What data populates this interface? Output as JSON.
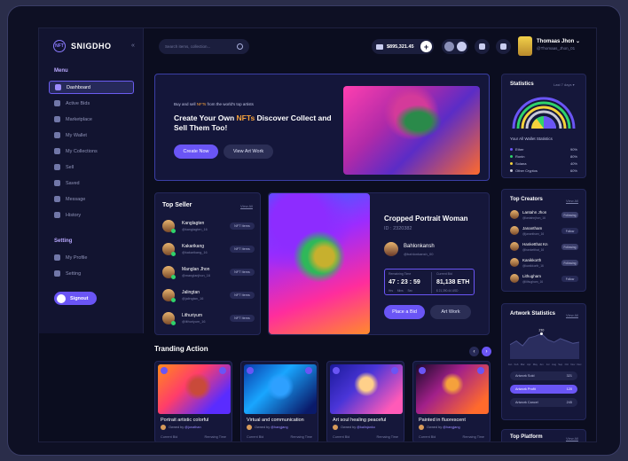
{
  "brand": {
    "name": "SNIGDHO",
    "logo_text": "NFT"
  },
  "sidebar": {
    "menu_title": "Menu",
    "items": [
      {
        "label": "Dashboard",
        "active": true
      },
      {
        "label": "Active Bids"
      },
      {
        "label": "Marketplace"
      },
      {
        "label": "My Wallet"
      },
      {
        "label": "My Collections"
      },
      {
        "label": "Sell"
      },
      {
        "label": "Saved"
      },
      {
        "label": "Message"
      },
      {
        "label": "History"
      }
    ],
    "setting_title": "Setting",
    "setting_items": [
      {
        "label": "My Profile"
      },
      {
        "label": "Setting"
      }
    ],
    "signout": "Signout"
  },
  "header": {
    "search_placeholder": "Search items, collection...",
    "wallet_amount": "$895,321.45",
    "user_name": "Thomaas Jhon",
    "user_handle": "@Thomaas_Jhon_01"
  },
  "hero": {
    "sub_prefix": "Buy and sell ",
    "sub_hl": "NFTs",
    "sub_suffix": " from the world's top artists",
    "title_a": "Create Your Own ",
    "title_hl": "NFTs",
    "title_b": " Discover Collect and Sell Them Too!",
    "btn_create": "Create Now",
    "btn_view": "View Art Work"
  },
  "top_seller": {
    "title": "Top Seller",
    "view_all": "View All",
    "sellers": [
      {
        "name": "Kanglagten",
        "handle": "@kanglagten_16",
        "badge": "NFT Items"
      },
      {
        "name": "Kakarikang",
        "handle": "@kakarikang_16",
        "badge": "NFT Items"
      },
      {
        "name": "Manglan Jhon",
        "handle": "@manglanjhon_16",
        "badge": "NFT Items"
      },
      {
        "name": "Jalingtan",
        "handle": "@jalingtan_16",
        "badge": "NFT Items"
      },
      {
        "name": "Lithuriyum",
        "handle": "@lithuriyum_16",
        "badge": "NFT Items"
      }
    ]
  },
  "featured": {
    "title": "Cropped Portrait Woman",
    "id": "ID : 2320382",
    "owner": "Bahlonkansh",
    "owner_handle": "@bahlonkansh_00",
    "remaining_label": "Remaining Time",
    "remaining_value": "47 : 23 : 59",
    "remaining_units": "Hrs Mins Sec",
    "bid_label": "Current Bid",
    "bid_value": "81,138 ETH",
    "bid_sub": "$ 21,390.44 USD",
    "btn_bid": "Place a Bid",
    "btn_art": "Art Work"
  },
  "trending": {
    "title": "Tranding Action",
    "cards": [
      {
        "title": "Portrait artistic colorful",
        "by": "Owned by ",
        "owner": "@jonathan",
        "l1": "Current Bid",
        "l2": "Remaing Time"
      },
      {
        "title": "Virtual and communication",
        "by": "Owned by ",
        "owner": "@hangjang",
        "l1": "Current Bid",
        "l2": "Remaing Time"
      },
      {
        "title": "Art soul healing peaceful",
        "by": "Owned by ",
        "owner": "@kalinjanko",
        "l1": "Current Bid",
        "l2": "Remaing Time"
      },
      {
        "title": "Painted in fluorescent",
        "by": "Owned by ",
        "owner": "@hangjang",
        "l1": "Current Bid",
        "l2": "Remaing Time"
      }
    ]
  },
  "statistics": {
    "title": "Statistics",
    "range": "Last 7 days ▾",
    "subtitle": "Your All Wallet Statistics",
    "items": [
      {
        "label": "Ether",
        "value": "90%",
        "color": "#6a55f5"
      },
      {
        "label": "Ronin",
        "value": "80%",
        "color": "#2fd36b"
      },
      {
        "label": "Solana",
        "value": "40%",
        "color": "#f5d23c"
      },
      {
        "label": "Other Cryptos",
        "value": "60%",
        "color": "#c8c8d8"
      }
    ]
  },
  "creators": {
    "title": "Top Creators",
    "view_all": "View All",
    "list": [
      {
        "name": "Lantahn Jhon",
        "handle": "@lantahnjhon_16",
        "btn": "Following"
      },
      {
        "name": "Janantham",
        "handle": "@janantham_16",
        "btn": "Follow"
      },
      {
        "name": "Hanketthat Kn",
        "handle": "@hanketthat_16",
        "btn": "Following"
      },
      {
        "name": "Kanikkorth",
        "handle": "@kanikkorth_16",
        "btn": "Following"
      },
      {
        "name": "Lithugham",
        "handle": "@lithugham_16",
        "btn": "Follow"
      }
    ]
  },
  "artwork_stats": {
    "title": "Artwork Statistics",
    "view_all": "View All",
    "peak_label": "210",
    "months": [
      "Jan",
      "Feb",
      "Mar",
      "Apr",
      "May",
      "Jun",
      "Jul",
      "Aug",
      "Sep",
      "Oct",
      "Nov",
      "Dec"
    ],
    "rows": [
      {
        "label": "Artwork Sold",
        "value": "321"
      },
      {
        "label": "Artwork Profit",
        "value": "120",
        "active": true
      },
      {
        "label": "Artwork Cancel",
        "value": "245"
      }
    ]
  },
  "platform": {
    "title": "Top Platform",
    "view_all": "View All"
  },
  "chart_data": {
    "type": "area",
    "categories": [
      "Jan",
      "Feb",
      "Mar",
      "Apr",
      "May",
      "Jun",
      "Jul",
      "Aug",
      "Sep",
      "Oct",
      "Nov",
      "Dec"
    ],
    "values": [
      120,
      150,
      110,
      175,
      190,
      210,
      160,
      140,
      170,
      150,
      130,
      140
    ],
    "title": "Artwork Statistics",
    "xlabel": "",
    "ylabel": "",
    "ylim": [
      0,
      250
    ]
  }
}
